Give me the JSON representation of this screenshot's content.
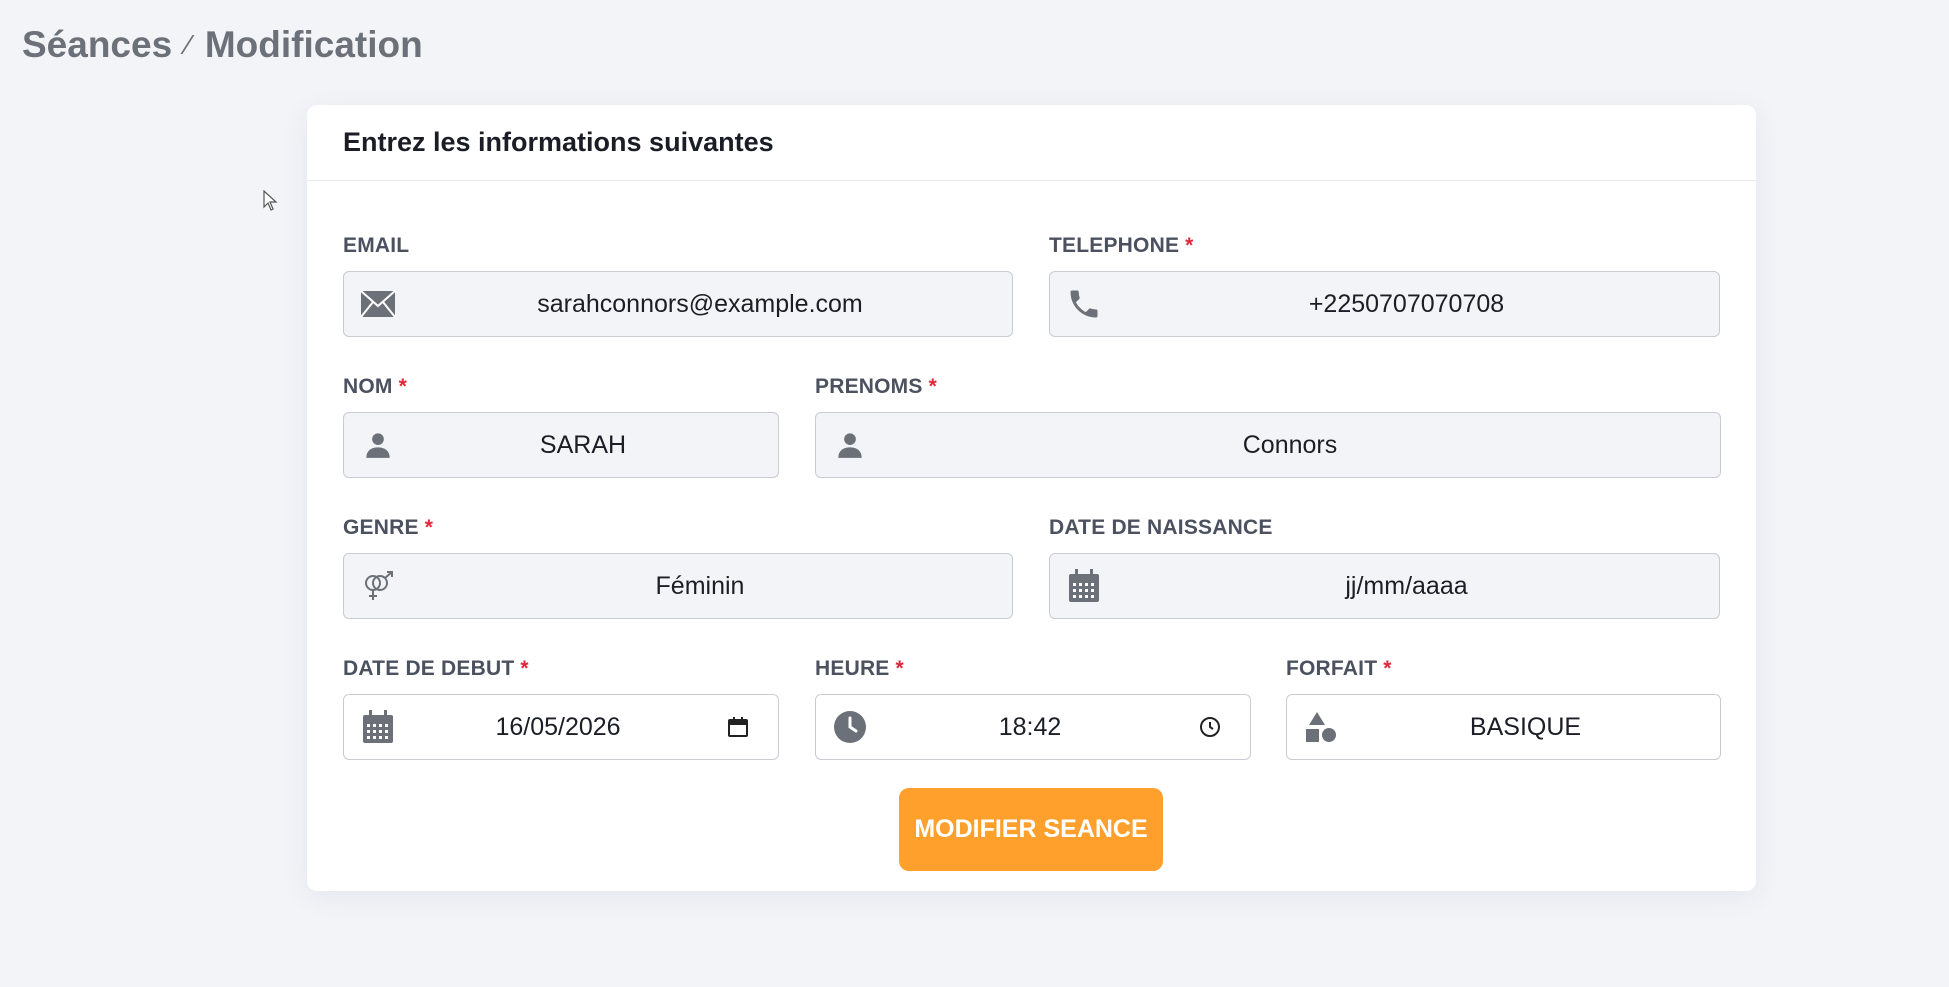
{
  "breadcrumb": {
    "parent": "Séances",
    "separator": "⁄",
    "current": "Modification"
  },
  "card": {
    "title": "Entrez les informations suivantes"
  },
  "fields": {
    "email": {
      "label": "EMAIL",
      "required": false,
      "value": "sarahconnors@example.com",
      "icon": "envelope-icon"
    },
    "telephone": {
      "label": "TELEPHONE",
      "required": true,
      "value": "+2250707070708",
      "icon": "phone-icon"
    },
    "nom": {
      "label": "NOM",
      "required": true,
      "value": "SARAH",
      "icon": "user-icon"
    },
    "prenoms": {
      "label": "PRENOMS",
      "required": true,
      "value": "Connors",
      "icon": "user-icon"
    },
    "genre": {
      "label": "GENRE",
      "required": true,
      "value": "Féminin",
      "icon": "gender-icon"
    },
    "date_naissance": {
      "label": "DATE DE NAISSANCE",
      "required": false,
      "placeholder": "jj/mm/aaaa",
      "icon": "calendar-icon"
    },
    "date_debut": {
      "label": "DATE DE DEBUT",
      "required": true,
      "value": "16/05/2026",
      "icon": "calendar-icon"
    },
    "heure": {
      "label": "HEURE",
      "required": true,
      "value": "18:42",
      "icon": "clock-icon"
    },
    "forfait": {
      "label": "FORFAIT",
      "required": true,
      "value": "BASIQUE",
      "icon": "shapes-icon"
    }
  },
  "required_marker": "*",
  "submit": {
    "label": "MODIFIER SEANCE"
  },
  "colors": {
    "accent": "#ff9f2c",
    "required": "#e0283a",
    "icon": "#6b7079"
  }
}
